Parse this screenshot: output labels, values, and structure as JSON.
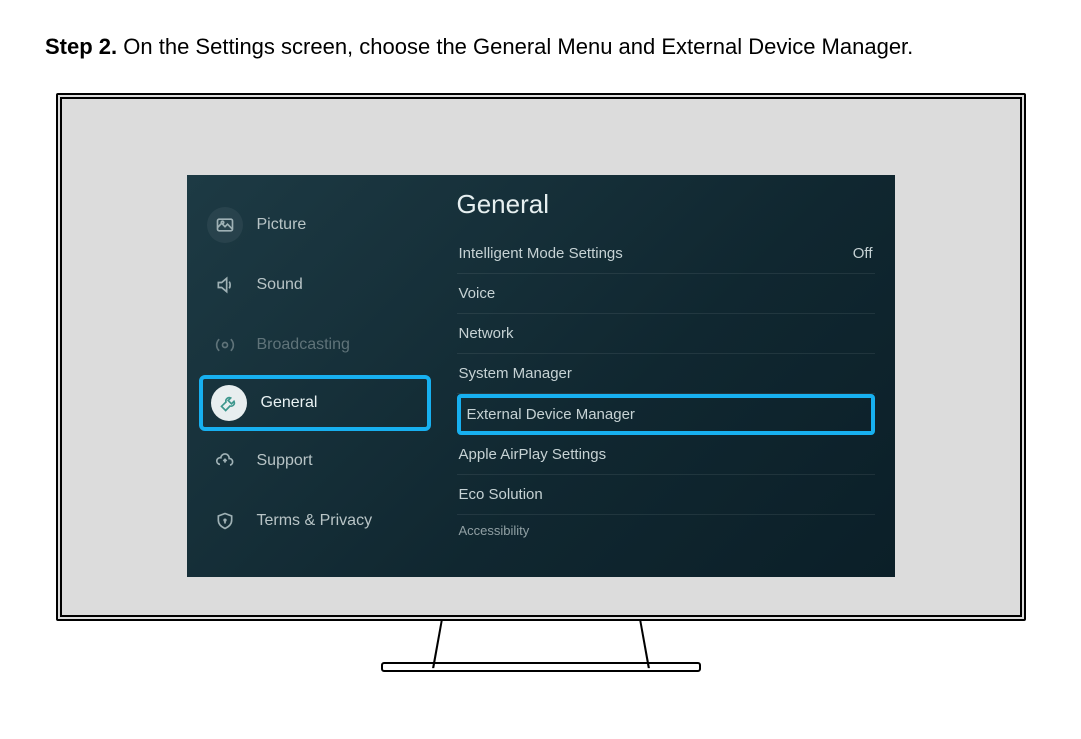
{
  "instruction": {
    "step_label": "Step 2.",
    "text": "On the Settings screen, choose the General Menu and External Device Manager."
  },
  "tv": {
    "sidebar": {
      "items": [
        {
          "label": "Picture",
          "icon": "picture-icon"
        },
        {
          "label": "Sound",
          "icon": "sound-icon"
        },
        {
          "label": "Broadcasting",
          "icon": "broadcast-icon"
        },
        {
          "label": "General",
          "icon": "wrench-icon"
        },
        {
          "label": "Support",
          "icon": "cloud-icon"
        },
        {
          "label": "Terms & Privacy",
          "icon": "shield-icon"
        }
      ]
    },
    "content": {
      "title": "General",
      "options": [
        {
          "label": "Intelligent Mode Settings",
          "value": "Off"
        },
        {
          "label": "Voice",
          "value": ""
        },
        {
          "label": "Network",
          "value": ""
        },
        {
          "label": "System Manager",
          "value": ""
        },
        {
          "label": "External Device Manager",
          "value": ""
        },
        {
          "label": "Apple AirPlay Settings",
          "value": ""
        },
        {
          "label": "Eco Solution",
          "value": ""
        },
        {
          "label": "Accessibility",
          "value": ""
        }
      ]
    }
  }
}
